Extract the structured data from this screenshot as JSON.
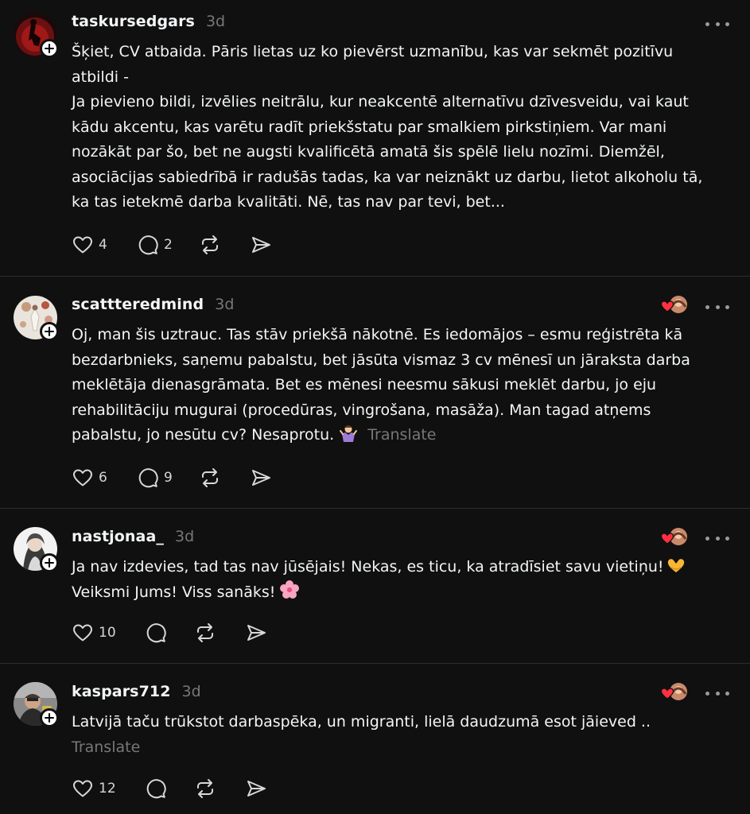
{
  "posts": [
    {
      "username": "taskursedgars",
      "time": "3d",
      "text": "Šķiet, CV atbaida. Pāris lietas uz ko pievērst uzmanību, kas var sekmēt pozitīvu\natbildi -\nJa pievieno bildi, izvēlies neitrālu, kur neakcentē alternatīvu dzīvesveidu, vai kaut\nkādu akcentu, kas varētu radīt priekšstatu par smalkiem pirkstiņiem. Var mani\nnozākāt par šo, bet ne augsti kvalificētā amatā šis spēlē lielu nozīmi. Diemžēl,\nasociācijas sabiedrībā ir radušās tadas, ka var neiznākt uz darbu, lietot alkoholu tā,\nka tas ietekmē darba kvalitāti. Nē, tas nav par tevi, bet...",
      "likes": "4",
      "replies": "2"
    },
    {
      "username": "scattteredmind",
      "time": "3d",
      "text": "Oj, man šis uztrauc. Tas stāv priekšā nākotnē. Es iedomājos – esmu reģistrēta kā\nbezdarbnieks, saņemu pabalstu, bet jāsūta vismaz 3 cv mēnesī un jāraksta darba\nmeklētāja dienasgrāmata. Bet es mēnesi neesmu sākusi meklēt darbu, jo eju\nrehabilitāciju mugurai (procedūras, vingrošana, masāža). Man tagad atņems\npabalstu, jo nesūtu cv? Nesaprotu.",
      "translate": "Translate",
      "likes": "6",
      "replies": "9"
    },
    {
      "username": "nastjonaa_",
      "time": "3d",
      "text_line1": "Ja nav izdevies, tad tas nav jūsējais! Nekas, es ticu, ka atradīsiet savu vietiņu!",
      "text_line2": "Veiksmi Jums! Viss sanāks!",
      "likes": "10",
      "replies": ""
    },
    {
      "username": "kaspars712",
      "time": "3d",
      "text": "Latvijā taču trūkstot darbaspēka, un migranti, lielā daudzumā esot jāieved ..",
      "translate": "Translate",
      "likes": "12",
      "replies": ""
    }
  ],
  "icons": {
    "like": "heart-icon",
    "reply": "comment-bubble-icon",
    "repost": "repost-icon",
    "share": "send-icon",
    "more": "more-horizontal-icon",
    "follow": "plus-icon"
  },
  "colors": {
    "background": "#101010",
    "text": "#f3f5f7",
    "muted": "#777777",
    "divider": "#2d2d2d",
    "like_heart": "#ff3040"
  }
}
